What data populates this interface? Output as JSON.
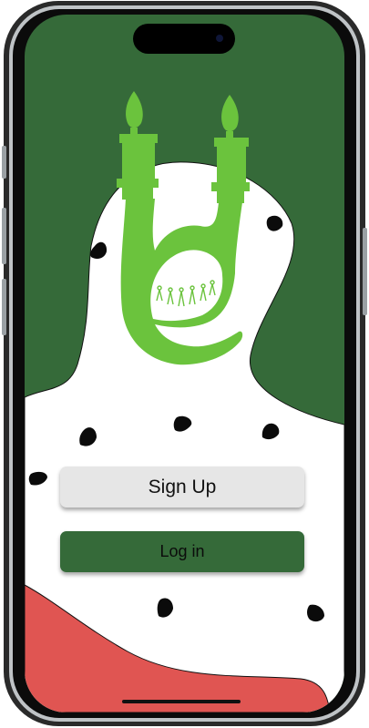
{
  "colors": {
    "background_green": "#356a39",
    "logo_green": "#6bc33d",
    "accent_red": "#e05552",
    "button_light": "#e6e6e6",
    "button_dark": "#356a39"
  },
  "buttons": {
    "signup_label": "Sign Up",
    "login_label": "Log in"
  },
  "icons": {
    "logo": "twin-minaret-logo-icon",
    "seeds": "watermelon-seed-icon"
  }
}
